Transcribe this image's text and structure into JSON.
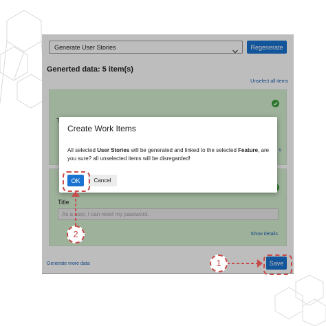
{
  "toolbar": {
    "dropdown_value": "Generate User Stories",
    "regenerate_label": "Regenerate"
  },
  "results": {
    "title": "Generted data: 5 item(s)",
    "unselect_all": "Unselect all items"
  },
  "cards": [
    {
      "partial_label": "T",
      "partial_link": "s"
    },
    {
      "title_label": "Title",
      "title_value": "As a user, I can reset my password.",
      "show_details": "Show details"
    }
  ],
  "footer": {
    "generate_more": "Generate more data",
    "save_label": "Save"
  },
  "dialog": {
    "title": "Create Work Items",
    "body_1": "All selected ",
    "body_bold_1": "User Stories",
    "body_2": " will be generated and linked to the selected ",
    "body_bold_2": "Feature",
    "body_3": ", are you sure? all unselected items will be disregarded!",
    "ok_label": "OK",
    "cancel_label": "Cancel"
  },
  "annotations": {
    "step1": "1",
    "step2": "2"
  },
  "colors": {
    "accent": "#1a73d0",
    "card_bg": "#d6f0d2",
    "annotation": "#c94a4a",
    "success": "#3aa13a"
  },
  "icons": {
    "dropdown": "chevron-down-icon",
    "selected": "check-circle-icon"
  }
}
